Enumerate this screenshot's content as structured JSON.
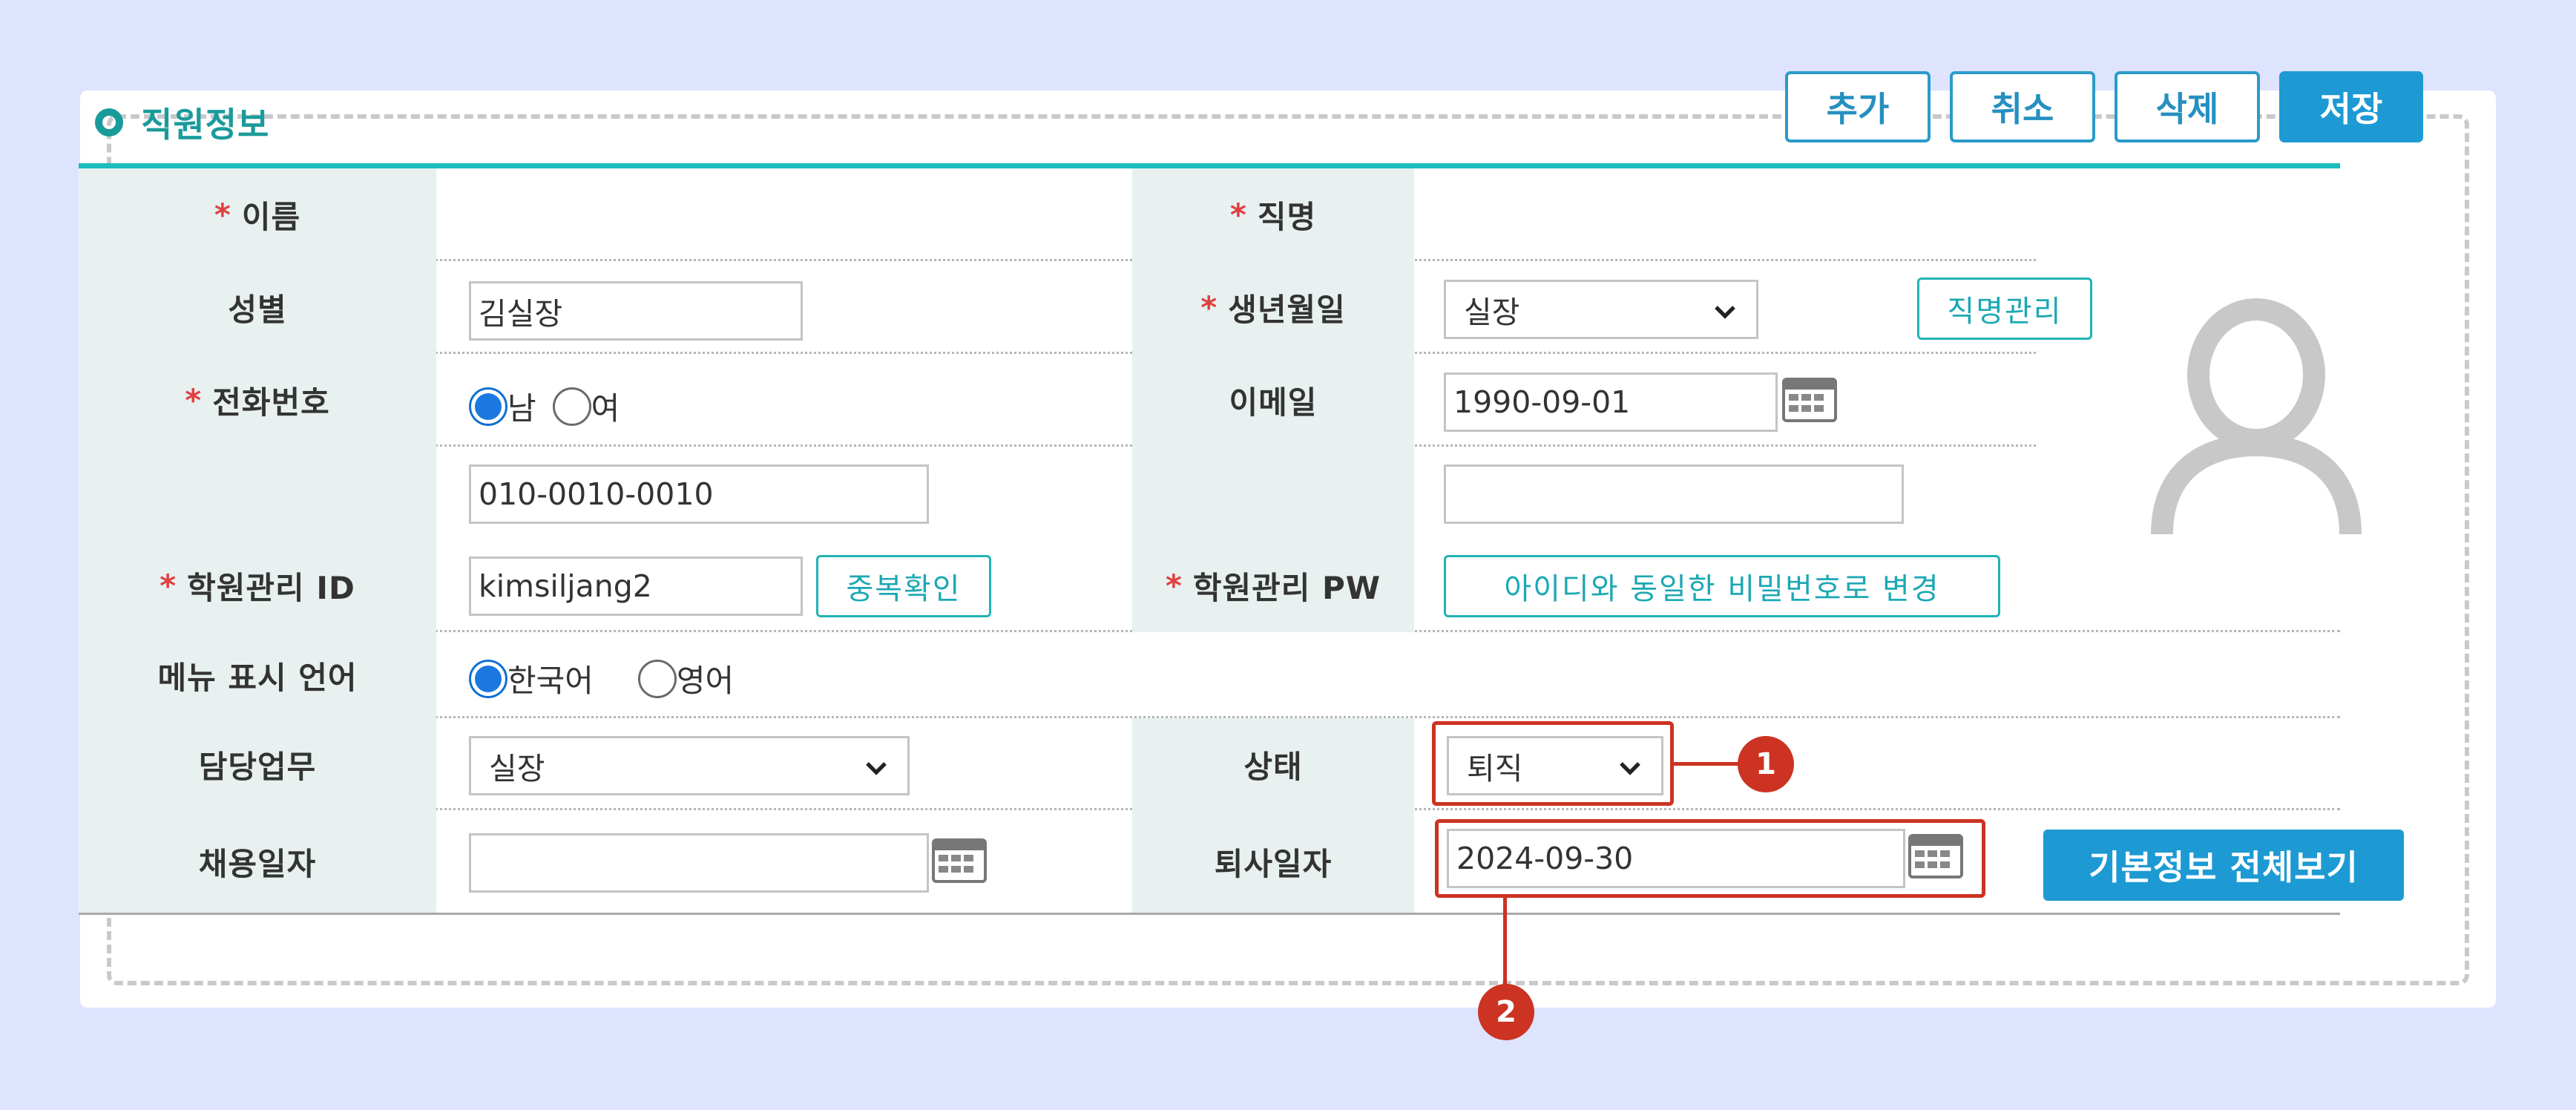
{
  "section": {
    "title": "직원정보"
  },
  "toolbar": {
    "add_label": "추가",
    "cancel_label": "취소",
    "delete_label": "삭제",
    "save_label": "저장"
  },
  "form": {
    "required_mark": "*",
    "name": {
      "label": "이름",
      "value": "김실장"
    },
    "position": {
      "label": "직명",
      "value": "실장",
      "manage_label": "직명관리"
    },
    "gender": {
      "label": "성별",
      "options": [
        "남",
        "여"
      ],
      "selected": "남"
    },
    "birth": {
      "label": "생년월일",
      "value": "1990-09-01"
    },
    "phone": {
      "label": "전화번호",
      "value": "010-0010-0010"
    },
    "email": {
      "label": "이메일",
      "value": ""
    },
    "login_id": {
      "label": "학원관리 ID",
      "value": "kimsiljang2",
      "check_label": "중복확인"
    },
    "login_pw": {
      "label": "학원관리 PW",
      "reset_label": "아이디와 동일한 비밀번호로 변경"
    },
    "menu_language": {
      "label": "메뉴 표시 언어",
      "options": [
        "한국어",
        "영어"
      ],
      "selected": "한국어"
    },
    "duty": {
      "label": "담당업무",
      "value": "실장"
    },
    "status": {
      "label": "상태",
      "value": "퇴직"
    },
    "hire_date": {
      "label": "채용일자",
      "value": ""
    },
    "retire_date": {
      "label": "퇴사일자",
      "value": "2024-09-30"
    }
  },
  "view_all_label": "기본정보 전체보기",
  "annotations": {
    "marker1": "1",
    "marker2": "2"
  },
  "colors": {
    "accent": "#1d9ad3",
    "teal": "#1bbdbd",
    "highlight": "#cc3322",
    "background": "#dee4fe"
  },
  "icons": [
    "calendar-icon",
    "chevron-down-icon",
    "user-avatar-icon"
  ]
}
